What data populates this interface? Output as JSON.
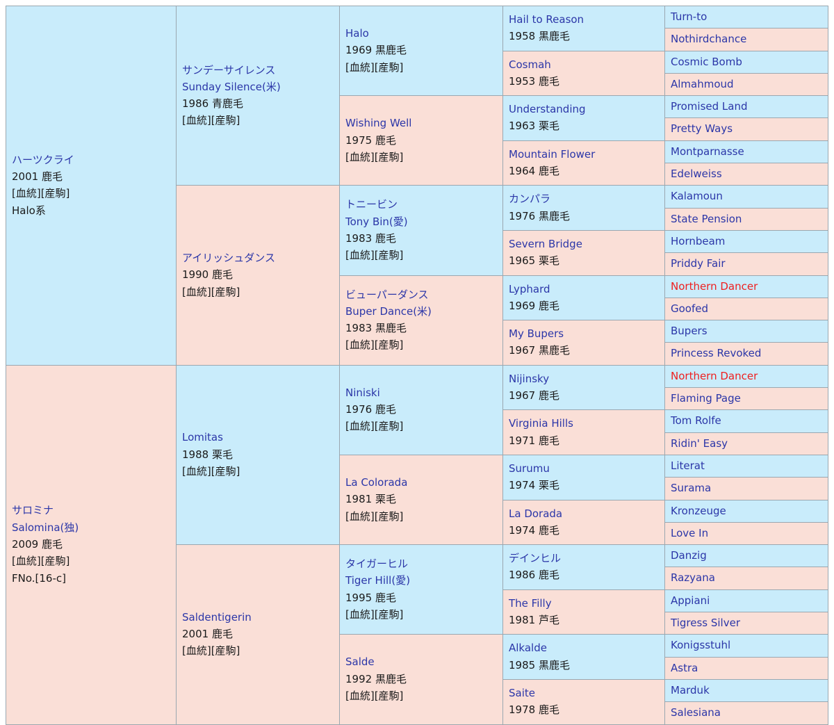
{
  "colors": {
    "sire_line_bg": "#c9ecfb",
    "dam_line_bg": "#fadfd7",
    "link_text": "#2b36a8",
    "inbreeding_text": "#ef2020",
    "border": "#9aa7b0"
  },
  "labels": {
    "pedigree_link": "[血統]",
    "offspring_link": "[産駒]",
    "bracket_open": "[",
    "bracket_close": "]",
    "pedigree_word": "血統",
    "offspring_word": "産駒"
  },
  "subject": {
    "name_jp": "サロミナ",
    "name_en": "Salomina(独)",
    "meta": "2009 鹿毛",
    "links": "[血統][産駒]",
    "fno": "FNo.[16-c]"
  },
  "gen1": [
    {
      "name_jp": "ハーツクライ",
      "name_en": "",
      "meta": "2001 鹿毛",
      "links": "[血統][産駒]",
      "extra": "Halo系",
      "line": "sire"
    },
    {
      "name_jp": "サロミナ",
      "name_en": "Salomina(独)",
      "meta": "2009 鹿毛",
      "links": "[血統][産駒]",
      "extra": "FNo.[16-c]",
      "line": "dam"
    }
  ],
  "gen2": [
    {
      "name_jp": "サンデーサイレンス",
      "name_en": "Sunday Silence(米)",
      "meta": "1986 青鹿毛",
      "links": "[血統][産駒]",
      "line": "sire"
    },
    {
      "name_jp": "アイリッシュダンス",
      "name_en": "",
      "meta": "1990 鹿毛",
      "links": "[血統][産駒]",
      "line": "dam"
    },
    {
      "name_jp": "",
      "name_en": "Lomitas",
      "meta": "1988 栗毛",
      "links": "[血統][産駒]",
      "line": "sire"
    },
    {
      "name_jp": "",
      "name_en": "Saldentigerin",
      "meta": "2001 鹿毛",
      "links": "[血統][産駒]",
      "line": "dam"
    }
  ],
  "gen3": [
    {
      "name_jp": "",
      "name_en": "Halo",
      "meta": "1969 黒鹿毛",
      "links": "[血統][産駒]",
      "line": "sire"
    },
    {
      "name_jp": "",
      "name_en": "Wishing Well",
      "meta": "1975 鹿毛",
      "links": "[血統][産駒]",
      "line": "dam"
    },
    {
      "name_jp": "トニービン",
      "name_en": "Tony Bin(愛)",
      "meta": "1983 鹿毛",
      "links": "[血統][産駒]",
      "line": "sire"
    },
    {
      "name_jp": "ビューパーダンス",
      "name_en": "Buper Dance(米)",
      "meta": "1983 黒鹿毛",
      "links": "[血統][産駒]",
      "line": "dam"
    },
    {
      "name_jp": "",
      "name_en": "Niniski",
      "meta": "1976 鹿毛",
      "links": "[血統][産駒]",
      "line": "sire"
    },
    {
      "name_jp": "",
      "name_en": "La Colorada",
      "meta": "1981 栗毛",
      "links": "[血統][産駒]",
      "line": "dam"
    },
    {
      "name_jp": "タイガーヒル",
      "name_en": "Tiger Hill(愛)",
      "meta": "1995 鹿毛",
      "links": "[血統][産駒]",
      "line": "sire"
    },
    {
      "name_jp": "",
      "name_en": "Salde",
      "meta": "1992 黒鹿毛",
      "links": "[血統][産駒]",
      "line": "dam"
    }
  ],
  "gen4": [
    {
      "name_jp": "",
      "name_en": "Hail to Reason",
      "meta": "1958 黒鹿毛",
      "line": "sire"
    },
    {
      "name_jp": "",
      "name_en": "Cosmah",
      "meta": "1953 鹿毛",
      "line": "dam"
    },
    {
      "name_jp": "",
      "name_en": "Understanding",
      "meta": "1963 栗毛",
      "line": "sire"
    },
    {
      "name_jp": "",
      "name_en": "Mountain Flower",
      "meta": "1964 鹿毛",
      "line": "dam"
    },
    {
      "name_jp": "カンパラ",
      "name_en": "",
      "meta": "1976 黒鹿毛",
      "line": "sire"
    },
    {
      "name_jp": "",
      "name_en": "Severn Bridge",
      "meta": "1965 栗毛",
      "line": "dam"
    },
    {
      "name_jp": "",
      "name_en": "Lyphard",
      "meta": "1969 鹿毛",
      "line": "sire"
    },
    {
      "name_jp": "",
      "name_en": "My Bupers",
      "meta": "1967 黒鹿毛",
      "line": "dam"
    },
    {
      "name_jp": "",
      "name_en": "Nijinsky",
      "meta": "1967 鹿毛",
      "line": "sire"
    },
    {
      "name_jp": "",
      "name_en": "Virginia Hills",
      "meta": "1971 鹿毛",
      "line": "dam"
    },
    {
      "name_jp": "",
      "name_en": "Surumu",
      "meta": "1974 栗毛",
      "line": "sire"
    },
    {
      "name_jp": "",
      "name_en": "La Dorada",
      "meta": "1974 鹿毛",
      "line": "dam"
    },
    {
      "name_jp": "デインヒル",
      "name_en": "",
      "meta": "1986 鹿毛",
      "line": "sire"
    },
    {
      "name_jp": "",
      "name_en": "The Filly",
      "meta": "1981 芦毛",
      "line": "dam"
    },
    {
      "name_jp": "",
      "name_en": "Alkalde",
      "meta": "1985 黒鹿毛",
      "line": "sire"
    },
    {
      "name_jp": "",
      "name_en": "Saite",
      "meta": "1978 鹿毛",
      "line": "dam"
    }
  ],
  "gen5": [
    {
      "name": "Turn-to",
      "line": "sire",
      "inbred": false
    },
    {
      "name": "Nothirdchance",
      "line": "dam",
      "inbred": false
    },
    {
      "name": "Cosmic Bomb",
      "line": "sire",
      "inbred": false
    },
    {
      "name": "Almahmoud",
      "line": "dam",
      "inbred": false
    },
    {
      "name": "Promised Land",
      "line": "sire",
      "inbred": false
    },
    {
      "name": "Pretty Ways",
      "line": "dam",
      "inbred": false
    },
    {
      "name": "Montparnasse",
      "line": "sire",
      "inbred": false
    },
    {
      "name": "Edelweiss",
      "line": "dam",
      "inbred": false
    },
    {
      "name": "Kalamoun",
      "line": "sire",
      "inbred": false
    },
    {
      "name": "State Pension",
      "line": "dam",
      "inbred": false
    },
    {
      "name": "Hornbeam",
      "line": "sire",
      "inbred": false
    },
    {
      "name": "Priddy Fair",
      "line": "dam",
      "inbred": false
    },
    {
      "name": "Northern Dancer",
      "line": "sire",
      "inbred": true
    },
    {
      "name": "Goofed",
      "line": "dam",
      "inbred": false
    },
    {
      "name": "Bupers",
      "line": "sire",
      "inbred": false
    },
    {
      "name": "Princess Revoked",
      "line": "dam",
      "inbred": false
    },
    {
      "name": "Northern Dancer",
      "line": "sire",
      "inbred": true
    },
    {
      "name": "Flaming Page",
      "line": "dam",
      "inbred": false
    },
    {
      "name": "Tom Rolfe",
      "line": "sire",
      "inbred": false
    },
    {
      "name": "Ridin' Easy",
      "line": "dam",
      "inbred": false
    },
    {
      "name": "Literat",
      "line": "sire",
      "inbred": false
    },
    {
      "name": "Surama",
      "line": "dam",
      "inbred": false
    },
    {
      "name": "Kronzeuge",
      "line": "sire",
      "inbred": false
    },
    {
      "name": "Love In",
      "line": "dam",
      "inbred": false
    },
    {
      "name": "Danzig",
      "line": "sire",
      "inbred": false
    },
    {
      "name": "Razyana",
      "line": "dam",
      "inbred": false
    },
    {
      "name": "Appiani",
      "line": "sire",
      "inbred": false
    },
    {
      "name": "Tigress Silver",
      "line": "dam",
      "inbred": false
    },
    {
      "name": "Konigsstuhl",
      "line": "sire",
      "inbred": false
    },
    {
      "name": "Astra",
      "line": "dam",
      "inbred": false
    },
    {
      "name": "Marduk",
      "line": "sire",
      "inbred": false
    },
    {
      "name": "Salesiana",
      "line": "dam",
      "inbred": false
    }
  ]
}
